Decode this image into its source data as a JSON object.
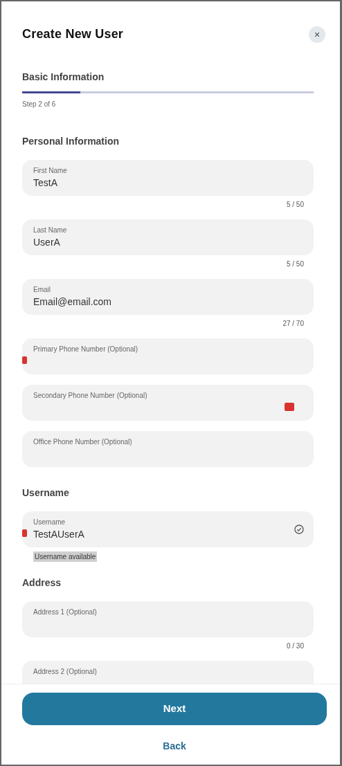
{
  "dialog": {
    "title": "Create New User",
    "close_icon": "×"
  },
  "progress": {
    "title": "Basic Information",
    "level": 0.2,
    "step": "Step 2 of 6"
  },
  "sections": [
    {
      "heading": "Personal Information",
      "fields": [
        {
          "label": "First Name",
          "value": "TestA",
          "counter": "5 / 50",
          "kind": "plain",
          "valid": false
        },
        {
          "label": "Last Name",
          "value": "UserA",
          "counter": "5 / 50",
          "kind": "plain",
          "valid": false
        },
        {
          "label": "Email",
          "value": "Email@email.com",
          "counter": "27 / 70",
          "kind": "plain",
          "valid": false
        },
        {
          "label": "Primary Phone Number (Optional)",
          "kind": "markstart",
          "valid": false
        },
        {
          "label": "Secondary Phone Number (Optional)",
          "kind": "markend",
          "valid": false
        },
        {
          "label": "Office Phone Number (Optional)",
          "kind": "plain",
          "valid": false
        }
      ]
    },
    {
      "heading": "Username",
      "fields": [
        {
          "label": "Username",
          "value": "TestAUserA",
          "helper": "Username available",
          "kind": "markstart",
          "valid": true
        }
      ]
    },
    {
      "heading": "Address",
      "fields": [
        {
          "label": "Address 1 (Optional)",
          "counter": "0 / 30",
          "kind": "plain",
          "valid": false
        },
        {
          "label": "Address 2 (Optional)",
          "kind": "plain",
          "valid": false
        }
      ]
    }
  ],
  "buttons": {
    "primary": "Next",
    "secondary": "Back"
  }
}
